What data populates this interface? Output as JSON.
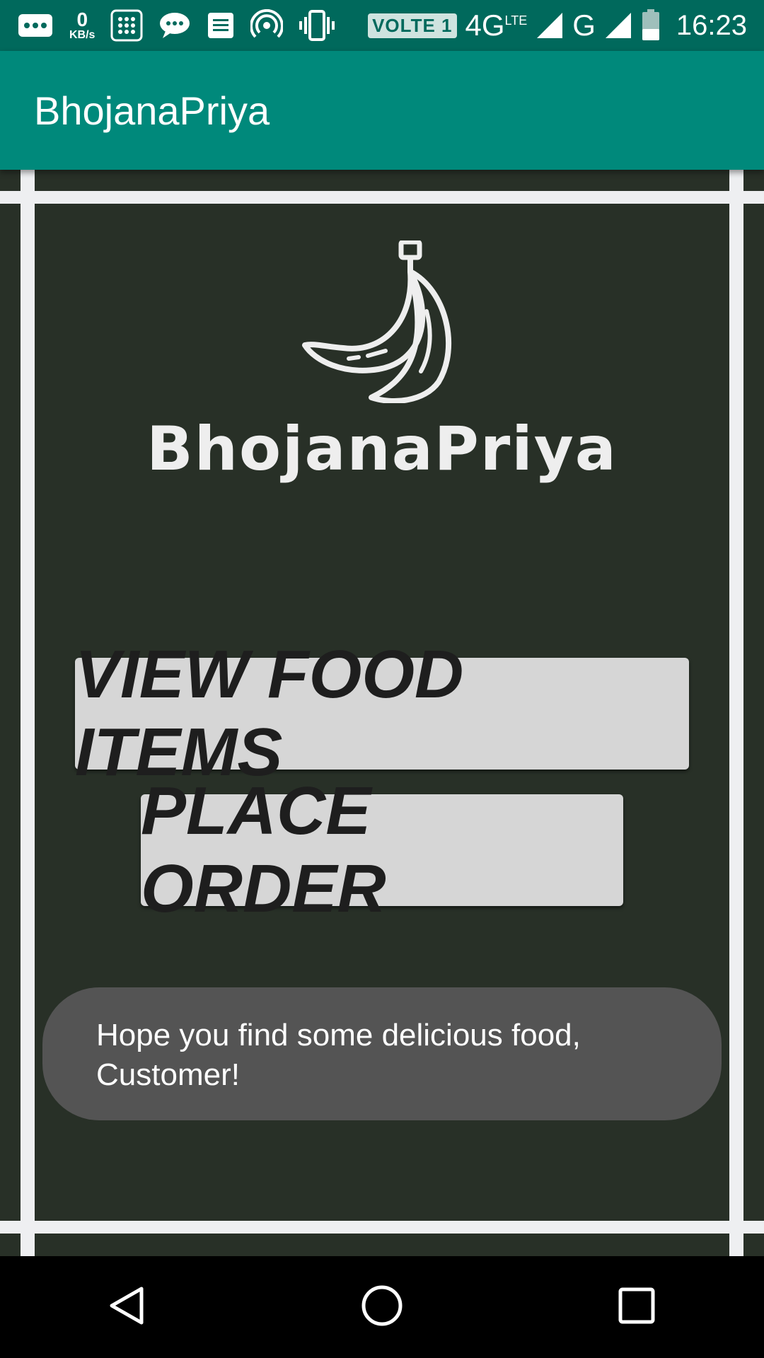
{
  "status_bar": {
    "speed_value": "0",
    "speed_unit": "KB/s",
    "volte_label": "VOLTE 1",
    "network_4g": "4G",
    "network_lte": "LTE",
    "network_g": "G",
    "time": "16:23",
    "icons": [
      "more-icon",
      "keypad-icon",
      "message-icon",
      "news-icon",
      "hotspot-icon",
      "vibrate-icon",
      "signal-icon",
      "battery-icon"
    ]
  },
  "app_bar": {
    "title": "BhojanaPriya"
  },
  "main": {
    "logo_text": "BhojanaPriya",
    "view_food_items_label": "VIEW FOOD ITEMS",
    "place_order_label": "PLACE ORDER",
    "toast_message": "Hope you find some delicious food, Customer!"
  },
  "nav_bar": {
    "icons": [
      "back-icon",
      "home-icon",
      "recents-icon"
    ]
  },
  "colors": {
    "status_bar": "#00695c",
    "app_bar": "#00897b",
    "background": "#283027",
    "frame": "#eeeff1",
    "button": "#d6d6d6",
    "toast": "#545454"
  }
}
